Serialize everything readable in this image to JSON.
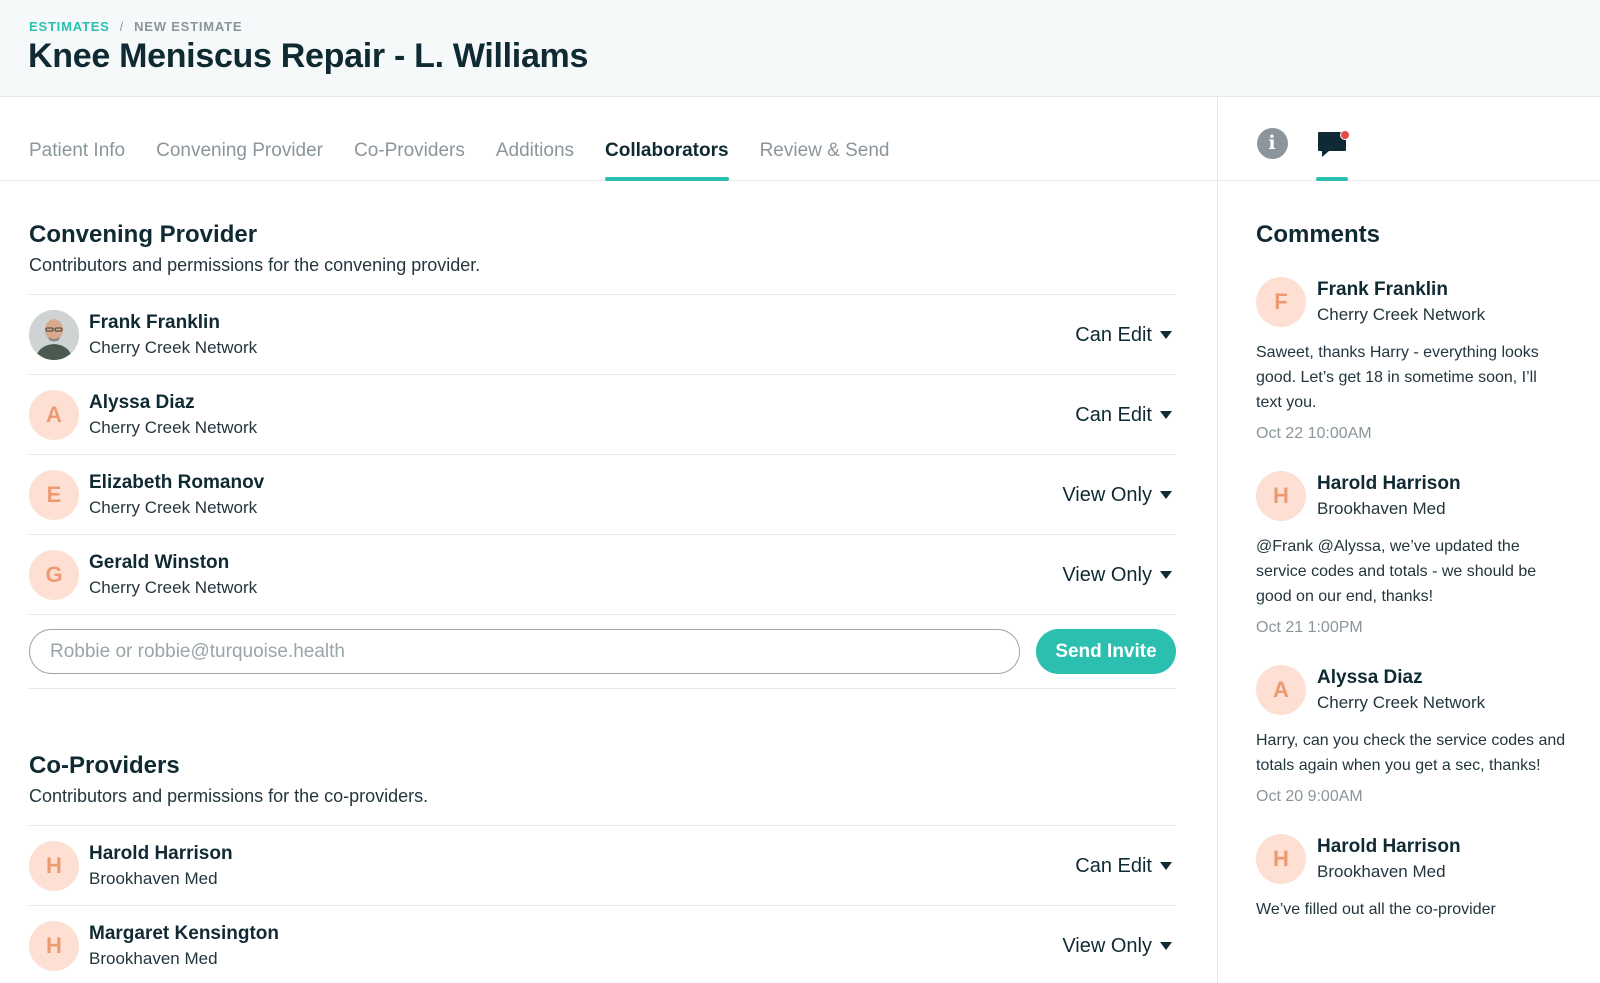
{
  "breadcrumb": {
    "parent": "ESTIMATES",
    "separator": "/",
    "current": "NEW ESTIMATE"
  },
  "page_title": "Knee Meniscus Repair - L. Williams",
  "tabs": [
    {
      "label": "Patient Info",
      "active": false
    },
    {
      "label": "Convening Provider",
      "active": false
    },
    {
      "label": "Co-Providers",
      "active": false
    },
    {
      "label": "Additions",
      "active": false
    },
    {
      "label": "Collaborators",
      "active": true
    },
    {
      "label": "Review & Send",
      "active": false
    }
  ],
  "side_panel_icons": [
    {
      "icon": "info-icon",
      "label": "i"
    },
    {
      "icon": "comment-icon",
      "has_notification": true,
      "active": true
    }
  ],
  "convening": {
    "title": "Convening Provider",
    "description": "Contributors and permissions for the convening provider.",
    "members": [
      {
        "initial": "",
        "avatar": "photo",
        "name": "Frank Franklin",
        "org": "Cherry Creek Network",
        "permission": "Can Edit"
      },
      {
        "initial": "A",
        "name": "Alyssa Diaz",
        "org": "Cherry Creek Network",
        "permission": "Can Edit"
      },
      {
        "initial": "E",
        "name": "Elizabeth Romanov",
        "org": "Cherry Creek Network",
        "permission": "View Only"
      },
      {
        "initial": "G",
        "name": "Gerald Winston",
        "org": "Cherry Creek Network",
        "permission": "View Only"
      }
    ],
    "invite": {
      "placeholder": "Robbie or robbie@turquoise.health",
      "button_label": "Send Invite"
    }
  },
  "co_providers": {
    "title": "Co-Providers",
    "description": "Contributors and permissions for the co-providers.",
    "members": [
      {
        "initial": "H",
        "name": "Harold Harrison",
        "org": "Brookhaven Med",
        "permission": "Can Edit"
      },
      {
        "initial": "H",
        "name": "Margaret Kensington",
        "org": "Brookhaven Med",
        "permission": "View Only"
      }
    ]
  },
  "comments": {
    "title": "Comments",
    "items": [
      {
        "initial": "F",
        "name": "Frank Franklin",
        "org": "Cherry Creek Network",
        "text": "Saweet, thanks Harry - everything looks good. Let’s get 18 in sometime soon, I’ll text you.",
        "time": "Oct 22 10:00AM"
      },
      {
        "initial": "H",
        "name": "Harold Harrison",
        "org": "Brookhaven Med",
        "text": "@Frank @Alyssa, we’ve updated the service codes and totals - we should be good on our end, thanks!",
        "time": "Oct 21 1:00PM"
      },
      {
        "initial": "A",
        "name": "Alyssa Diaz",
        "org": "Cherry Creek Network",
        "text": "Harry, can you check the service codes and totals again when you get a sec, thanks!",
        "time": "Oct 20 9:00AM"
      },
      {
        "initial": "H",
        "name": "Harold Harrison",
        "org": "Brookhaven Med",
        "text": "We’ve filled out all the co-provider",
        "time": ""
      }
    ]
  },
  "colors": {
    "accent": "#2bbfb0",
    "avatar_bg": "#fde0d3",
    "avatar_text": "#ec9a72",
    "notification": "#e8474a",
    "text_dark": "#0f2a33",
    "muted": "#8a969b"
  }
}
